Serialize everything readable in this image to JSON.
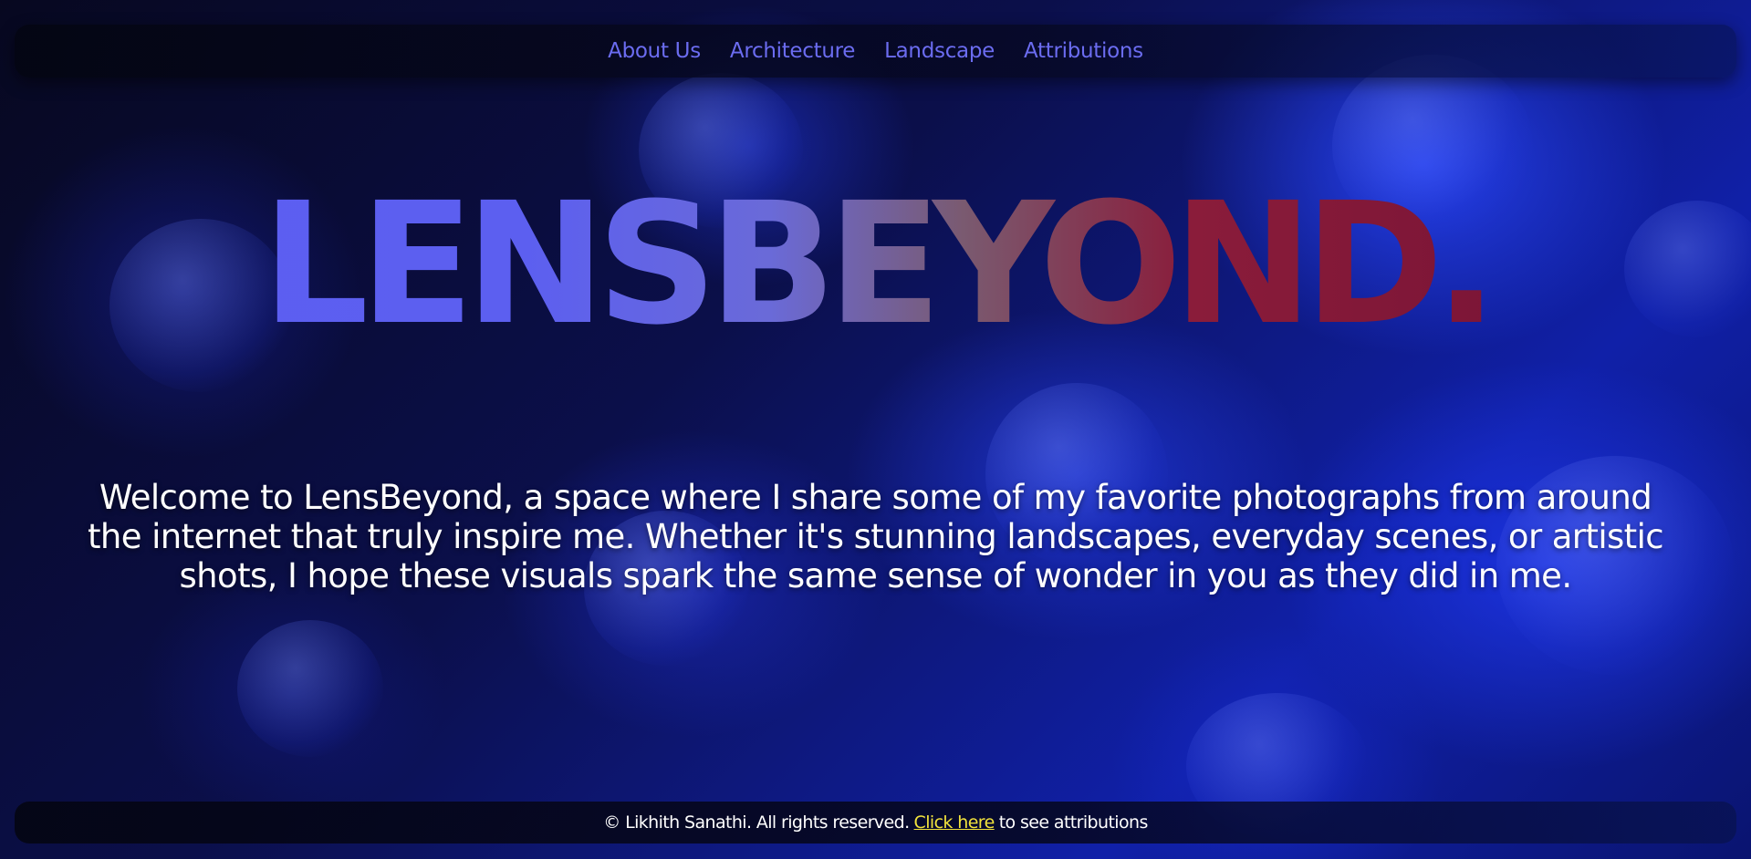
{
  "nav": {
    "items": [
      {
        "label": "About Us"
      },
      {
        "label": "Architecture"
      },
      {
        "label": "Landscape"
      },
      {
        "label": "Attributions"
      }
    ]
  },
  "hero": {
    "title": "LENSBEYOND."
  },
  "intro": {
    "text": "Welcome to LensBeyond, a space where I share some of my favorite photographs from around the internet that truly inspire me. Whether it's stunning landscapes, everyday scenes, or artistic shots, I hope these visuals spark the same sense of wonder in you as they did in me."
  },
  "footer": {
    "copyright": "© Likhith Sanathi. All rights reserved.",
    "link_label": "Click here",
    "suffix": "to see attributions"
  },
  "colors": {
    "nav_link": "#6b6cf0",
    "footer_link": "#f2e33c",
    "background": "#0b0f4a",
    "title_red": "#8a1c3a"
  }
}
